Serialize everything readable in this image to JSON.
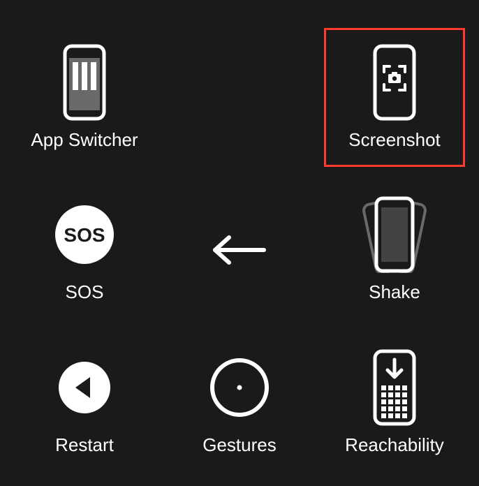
{
  "items": {
    "appSwitcher": {
      "label": "App Switcher"
    },
    "screenshot": {
      "label": "Screenshot"
    },
    "sos": {
      "label": "SOS",
      "iconText": "SOS"
    },
    "shake": {
      "label": "Shake"
    },
    "restart": {
      "label": "Restart"
    },
    "gestures": {
      "label": "Gestures"
    },
    "reachability": {
      "label": "Reachability"
    }
  },
  "highlighted": "screenshot"
}
